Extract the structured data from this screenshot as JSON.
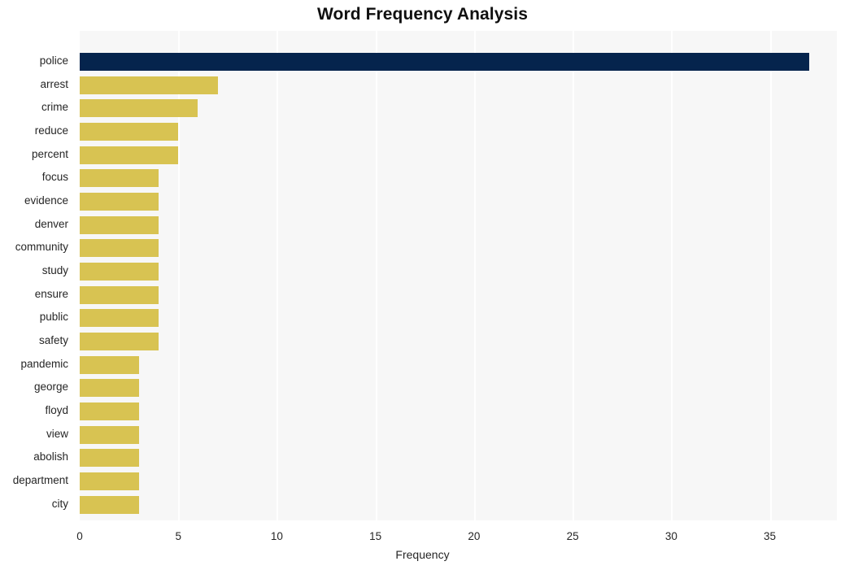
{
  "chart_data": {
    "type": "bar",
    "orientation": "horizontal",
    "title": "Word Frequency Analysis",
    "xlabel": "Frequency",
    "ylabel": "",
    "categories": [
      "police",
      "arrest",
      "crime",
      "reduce",
      "percent",
      "focus",
      "evidence",
      "denver",
      "community",
      "study",
      "ensure",
      "public",
      "safety",
      "pandemic",
      "george",
      "floyd",
      "view",
      "abolish",
      "department",
      "city"
    ],
    "values": [
      37,
      7,
      6,
      5,
      5,
      4,
      4,
      4,
      4,
      4,
      4,
      4,
      4,
      3,
      3,
      3,
      3,
      3,
      3,
      3
    ],
    "xlim": [
      0,
      38.4
    ],
    "xticks": [
      0,
      5,
      10,
      15,
      20,
      25,
      30,
      35
    ],
    "xtick_labels": [
      "0",
      "5",
      "10",
      "15",
      "20",
      "25",
      "30",
      "35"
    ],
    "grid": true,
    "gridlines_axis": "x",
    "legend": null,
    "bar_colors": {
      "highlight": "#05244d",
      "default": "#d8c352"
    },
    "highlight_category": "police",
    "plot_background": "#f7f7f7",
    "page_background": "#ffffff",
    "gridline_color": "#ffffff"
  }
}
